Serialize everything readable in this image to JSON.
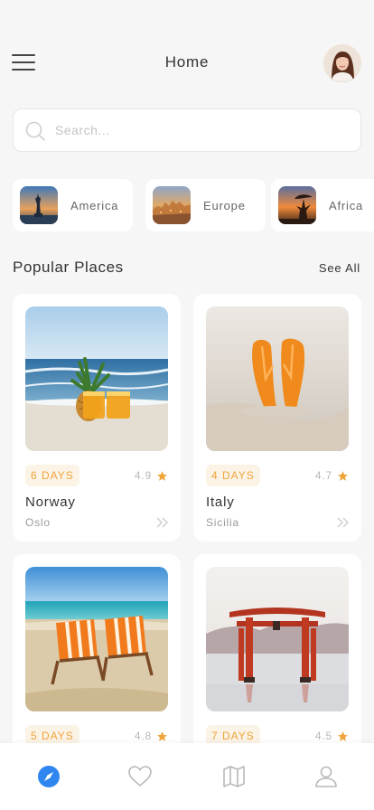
{
  "header": {
    "title": "Home",
    "menu_icon": "menu-icon",
    "avatar_icon": "user-avatar"
  },
  "search": {
    "placeholder": "Search...",
    "value": ""
  },
  "categories": [
    {
      "label": "America"
    },
    {
      "label": "Europe"
    },
    {
      "label": "Africa"
    }
  ],
  "popular": {
    "title": "Popular Places",
    "see_all": "See All"
  },
  "places": [
    {
      "days": "6 DAYS",
      "rating": "4.9",
      "name": "Norway",
      "sub": "Oslo"
    },
    {
      "days": "4 DAYS",
      "rating": "4.7",
      "name": "Italy",
      "sub": "Sicilia"
    },
    {
      "days": "5 DAYS",
      "rating": "4.8",
      "name": "",
      "sub": ""
    },
    {
      "days": "7 DAYS",
      "rating": "4.5",
      "name": "",
      "sub": ""
    }
  ],
  "bottom_nav": {
    "items": [
      "compass-icon",
      "heart-icon",
      "map-icon",
      "user-icon"
    ],
    "active_color": "#2f86f0",
    "inactive_color": "#b8b8b8"
  },
  "colors": {
    "accent": "#f0a43c",
    "badge_bg": "#fbf3e6",
    "background": "#f6f6f6"
  }
}
